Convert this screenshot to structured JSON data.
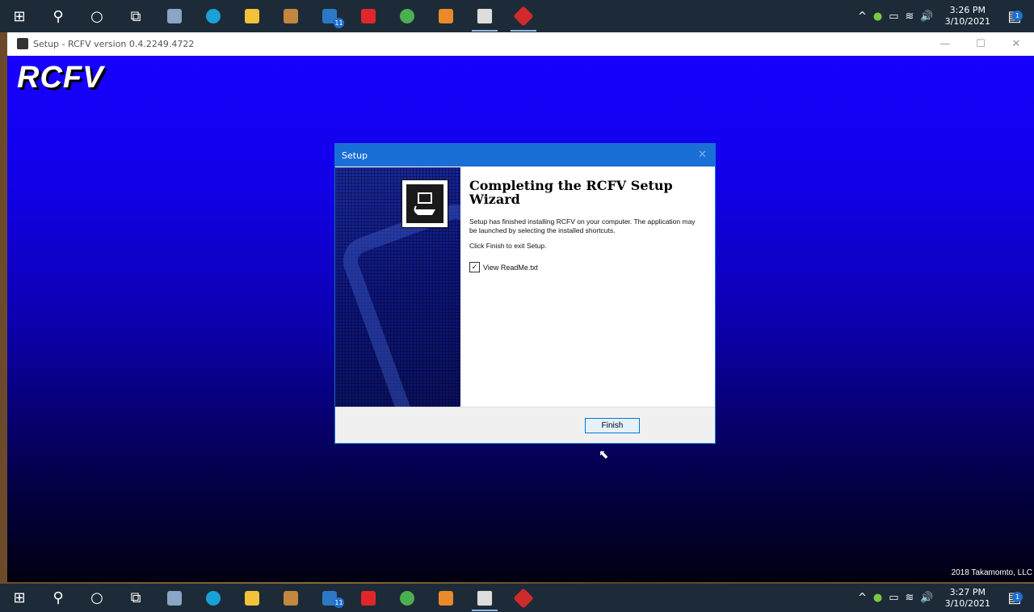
{
  "window": {
    "title": "Setup - RCFV version 0.4.2249.4722",
    "minimize": "—",
    "maximize": "☐",
    "close": "✕"
  },
  "installer": {
    "brand": "RCFV",
    "copyright": "2018 Takamomto, LLC"
  },
  "dialog": {
    "title": "Setup",
    "close": "✕",
    "heading": "Completing the RCFV Setup Wizard",
    "paragraph1": "Setup has finished installing RCFV on your computer. The application may be launched by selecting the installed shortcuts.",
    "paragraph2": "Click Finish to exit Setup.",
    "checkbox_label": "View ReadMe.txt",
    "checkbox_checked": true,
    "checkmark": "✓",
    "finish_label": "Finish"
  },
  "taskbar_top": {
    "time": "3:26 PM",
    "date": "3/10/2021",
    "mail_badge": "11",
    "notif_badge": "1"
  },
  "taskbar_bottom": {
    "time": "3:27 PM",
    "date": "3/10/2021",
    "mail_badge": "11",
    "notif_badge": "1"
  },
  "taskbar_icons": [
    "windows-start-icon",
    "search-icon",
    "cortana-icon",
    "task-view-icon",
    "photos-icon",
    "edge-icon",
    "file-explorer-icon",
    "game-icon",
    "mail-icon",
    "foxit-icon",
    "chrome-icon",
    "media-icon",
    "setup-app-icon",
    "misc-app-icon"
  ],
  "tray": {
    "chevron": "^",
    "volume": "🔊",
    "wifi": "≋"
  }
}
